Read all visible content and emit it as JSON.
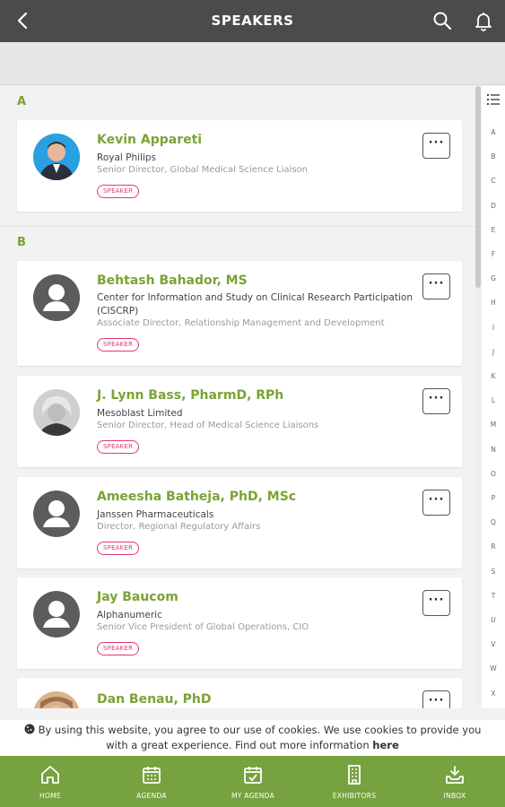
{
  "header": {
    "title": "SPEAKERS"
  },
  "sections": [
    {
      "letter": "A"
    },
    {
      "letter": "B"
    }
  ],
  "speakers": [
    {
      "name": "Kevin Appareti",
      "org": "Royal Philips",
      "role": "Senior Director, Global Medical Science Liaison",
      "badge": "SPEAKER"
    },
    {
      "name": "Behtash Bahador, MS",
      "org": "Center for Information and Study on Clinical Research Participation (CISCRP)",
      "role": "Associate Director, Relationship Management and Development",
      "badge": "SPEAKER"
    },
    {
      "name": "J. Lynn Bass, PharmD, RPh",
      "org": "Mesoblast Limited",
      "role": "Senior Director, Head of Medical Science Liaisons",
      "badge": "SPEAKER"
    },
    {
      "name": "Ameesha Batheja, PhD, MSc",
      "org": "Janssen Pharmaceuticals",
      "role": "Director, Regional Regulatory Affairs",
      "badge": "SPEAKER"
    },
    {
      "name": "Jay Baucom",
      "org": "Alphanumeric",
      "role": "Senior Vice President of Global Operations, CIO",
      "badge": "SPEAKER"
    },
    {
      "name": "Dan Benau, PhD"
    }
  ],
  "more_button": {
    "glyph": "···"
  },
  "alpha_index": [
    "A",
    "B",
    "C",
    "D",
    "E",
    "F",
    "G",
    "H",
    "I",
    "J",
    "K",
    "L",
    "M",
    "N",
    "O",
    "P",
    "Q",
    "R",
    "S",
    "T",
    "U",
    "V",
    "W",
    "X"
  ],
  "cookie_notice": {
    "text": "By using this website, you agree to our use of cookies. We use cookies to provide you with a great experience. Find out more information",
    "link": "here"
  },
  "tabs": [
    {
      "label": "HOME"
    },
    {
      "label": "AGENDA"
    },
    {
      "label": "MY AGENDA"
    },
    {
      "label": "EXHIBITORS"
    },
    {
      "label": "INBOX"
    }
  ],
  "colors": {
    "accent": "#76a23f",
    "name_green": "#7aa335",
    "badge_pink": "#e23a6d",
    "header": "#4b4b4e"
  }
}
